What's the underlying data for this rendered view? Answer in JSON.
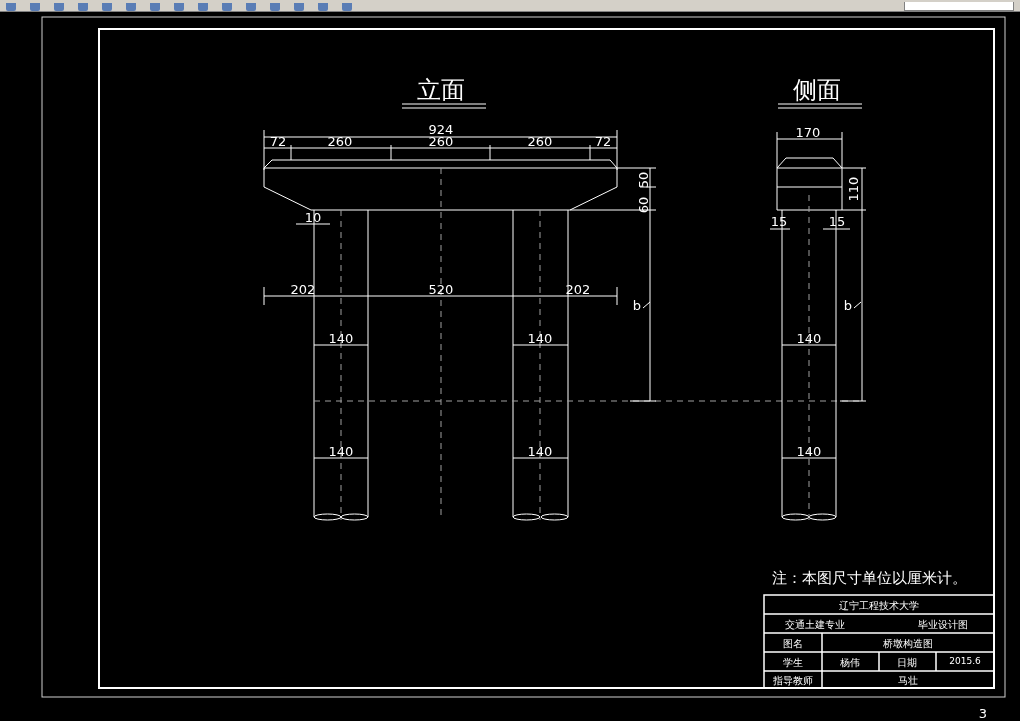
{
  "drawing": {
    "views": [
      {
        "title": "立面"
      },
      {
        "title": "侧面"
      }
    ],
    "front_dimensions": [
      "924",
      "72",
      "260",
      "260",
      "260",
      "72",
      "60",
      "50",
      "10",
      "202",
      "520",
      "202",
      "140",
      "140",
      "140",
      "140",
      "b"
    ],
    "side_dimensions": [
      "170",
      "110",
      "15",
      "15",
      "140",
      "140",
      "b"
    ],
    "note": "注：本图尺寸单位以厘米计。",
    "title_block": {
      "school": "辽宁工程技术大学",
      "major": "交通土建专业",
      "drawing_type": "毕业设计图",
      "name_label": "图名",
      "name": "桥墩构造图",
      "student_label": "学生",
      "student": "杨伟",
      "date_label": "日期",
      "date": "2015.6",
      "advisor_label": "指导教师",
      "advisor": "马壮"
    }
  },
  "page_number": "3"
}
